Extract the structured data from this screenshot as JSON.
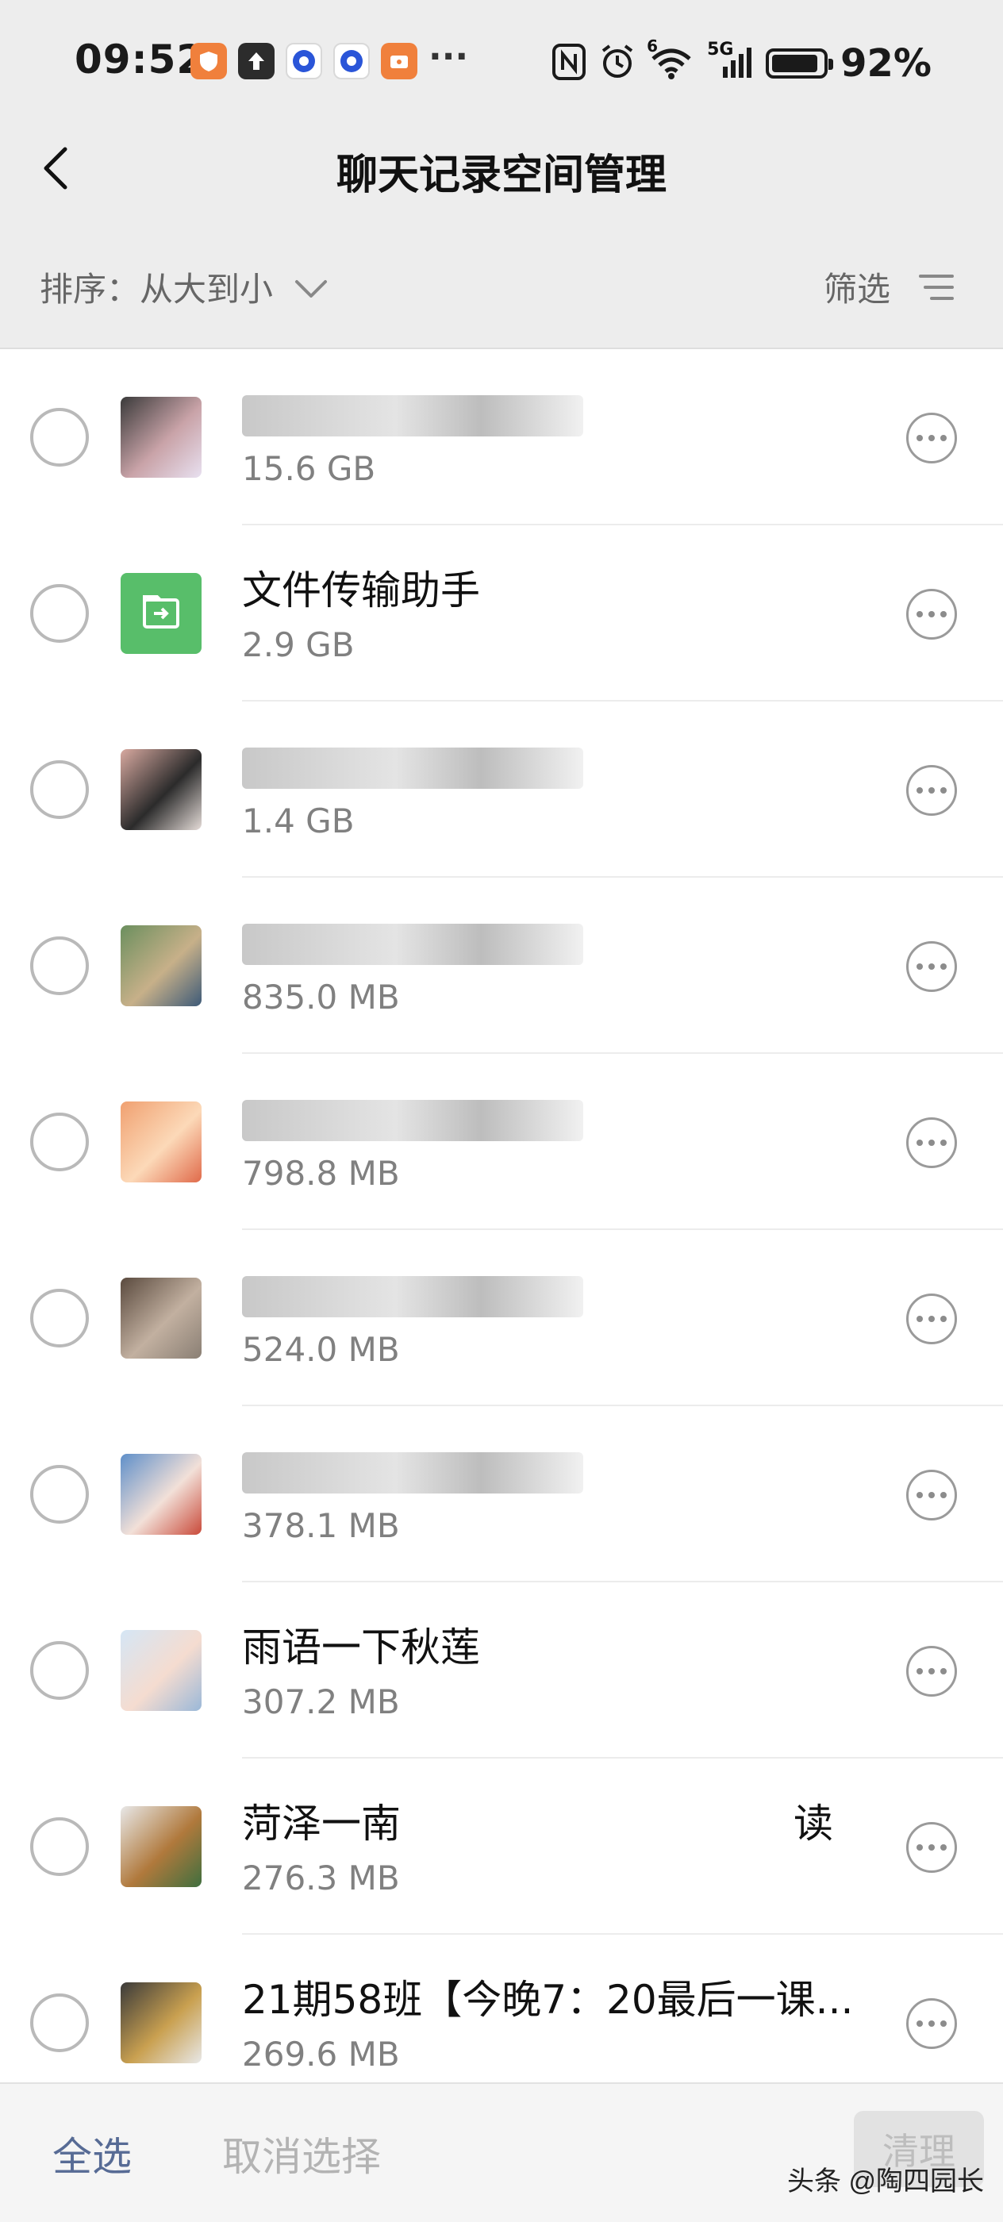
{
  "status_bar": {
    "time": "09:52",
    "battery": "92%",
    "battery_level": 0.92,
    "notification_icons": [
      "shield-app-icon",
      "upload-icon",
      "p-app-icon",
      "p-app-icon",
      "wallet-app-icon"
    ],
    "more_indicator": "···",
    "right_icons": [
      "nfc-icon",
      "alarm-icon",
      "wifi-icon",
      "signal-5g-icon",
      "battery-icon"
    ],
    "wifi_badge": "6",
    "network_badge": "5G"
  },
  "header": {
    "title": "聊天记录空间管理",
    "back_icon": "chevron-left-icon"
  },
  "sort_bar": {
    "sort_label": "排序：",
    "sort_value": "从大到小",
    "filter_label": "筛选"
  },
  "chats": [
    {
      "name": "",
      "size": "15.6 GB",
      "avatar_colors": [
        "#3a3a3a",
        "#c9a3a8",
        "#e8e0f0"
      ],
      "name_redacted": true
    },
    {
      "name": "文件传输助手",
      "size": "2.9 GB",
      "avatar_colors": [
        "#58be6a",
        "#ffffff"
      ],
      "name_redacted": false
    },
    {
      "name": "",
      "size": "1.4 GB",
      "avatar_colors": [
        "#d8a9a0",
        "#2b2b2b",
        "#e5dcd8"
      ],
      "name_redacted": true
    },
    {
      "name": "",
      "size": "835.0 MB",
      "avatar_colors": [
        "#6b8f5e",
        "#c7b089",
        "#3d5a78"
      ],
      "name_redacted": true
    },
    {
      "name": "",
      "size": "798.8 MB",
      "avatar_colors": [
        "#f0a070",
        "#fcd9b8",
        "#e06a4a"
      ],
      "name_redacted": true
    },
    {
      "name": "",
      "size": "524.0 MB",
      "avatar_colors": [
        "#5a4a3e",
        "#c2b0a0",
        "#8a7f74"
      ],
      "name_redacted": true
    },
    {
      "name": "",
      "size": "378.1 MB",
      "avatar_colors": [
        "#5f8fc9",
        "#f2e0d8",
        "#c94a3a"
      ],
      "name_redacted": true
    },
    {
      "name": "雨语一下秋莲",
      "size": "307.2 MB",
      "avatar_colors": [
        "#d5e6f5",
        "#f5dcd0",
        "#9ab8d8"
      ],
      "name_redacted": false
    },
    {
      "name": "菏泽一南",
      "name_tail": "读",
      "size": "276.3 MB",
      "avatar_colors": [
        "#e8e8e8",
        "#b0793c",
        "#3f6f3f"
      ],
      "name_redacted": false
    },
    {
      "name": "21期58班【今晚7：20最后一课...",
      "size": "269.6 MB",
      "avatar_colors": [
        "#3a3a3a",
        "#c9a050",
        "#e8e8e8"
      ],
      "name_redacted": false
    }
  ],
  "bottom_bar": {
    "select_all": "全选",
    "cancel_select": "取消选择",
    "clean": "清理",
    "watermark": "头条 @陶四园长"
  }
}
